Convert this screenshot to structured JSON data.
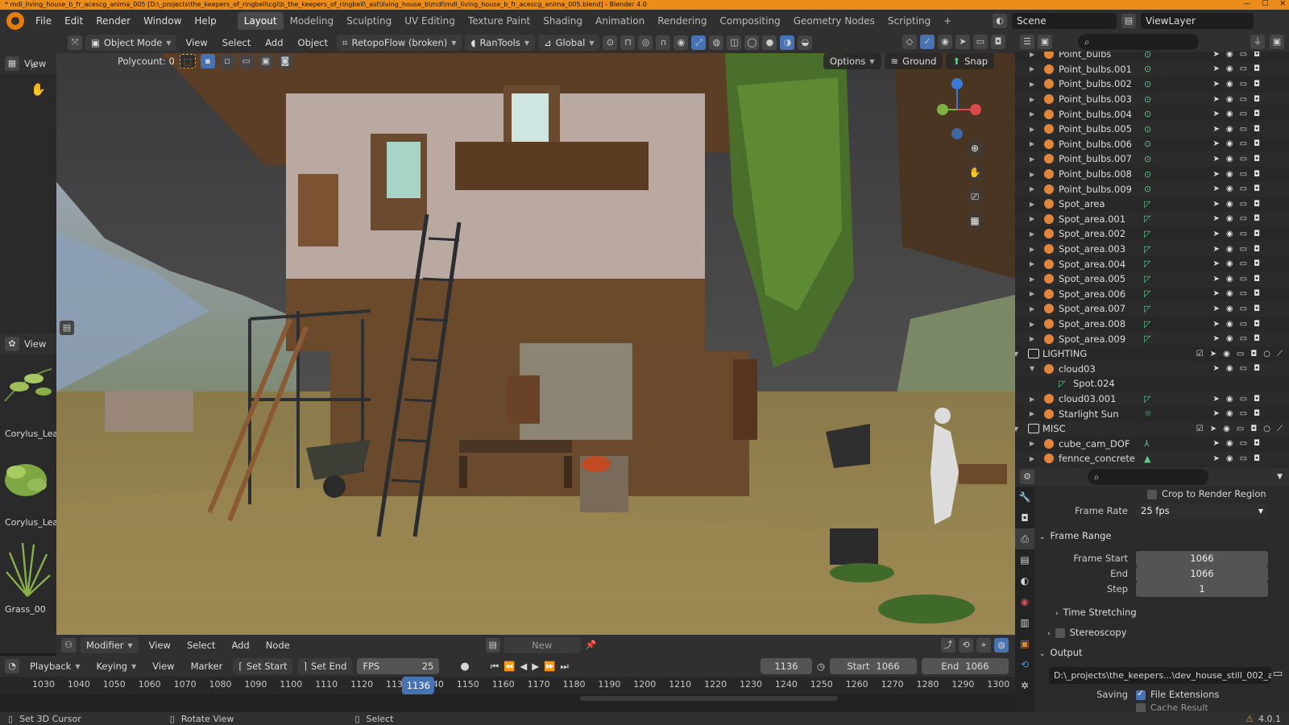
{
  "window": {
    "title": "* mdl_living_house_b_fr_acescg_anima_005 [D:\\_projects\\the_keepers_of_ringbell\\cgi\\b_the_keepers_of_ringbell\\_ast\\living_house_b\\mdl\\mdl_living_house_b_fr_acescg_anima_005.blend] - Blender 4.0",
    "version": "4.0.1"
  },
  "menubar": {
    "items": [
      "File",
      "Edit",
      "Render",
      "Window",
      "Help"
    ],
    "workspaces": [
      "Layout",
      "Modeling",
      "Sculpting",
      "UV Editing",
      "Texture Paint",
      "Shading",
      "Animation",
      "Rendering",
      "Compositing",
      "Geometry Nodes",
      "Scripting"
    ],
    "active_workspace": "Layout",
    "scene": "Scene",
    "view_layer": "ViewLayer"
  },
  "viewport_header": {
    "view_label": "View",
    "mode": "Object Mode",
    "menus": [
      "View",
      "Select",
      "Add",
      "Object"
    ],
    "retopo": "RetopoFlow (broken)",
    "rantools": "RanTools",
    "orientation": "Global",
    "polycount": "Polycount: 0",
    "options": "Options",
    "ground": "Ground",
    "snap": "Snap"
  },
  "asset_browser": {
    "view_label": "View",
    "items": [
      "Corylus_Leaf",
      "Corylus_Leaf",
      "Grass_00"
    ]
  },
  "node_header": {
    "editor": "Modifier",
    "menus": [
      "View",
      "Select",
      "Add",
      "Node"
    ],
    "new_button": "New"
  },
  "timeline": {
    "menus": [
      "Playback",
      "Keying",
      "View",
      "Marker"
    ],
    "set_start": "Set Start",
    "set_end": "Set End",
    "fps_label": "FPS",
    "fps_value": "25",
    "current_frame": "1136",
    "start_label": "Start",
    "start_value": "1066",
    "end_label": "End",
    "end_value": "1066",
    "ruler": [
      1030,
      1040,
      1050,
      1060,
      1070,
      1080,
      1090,
      1100,
      1110,
      1120,
      1130,
      1140,
      1150,
      1160,
      1170,
      1180,
      1190,
      1200,
      1210,
      1220,
      1230,
      1240,
      1250,
      1260,
      1270,
      1280,
      1290,
      1300
    ],
    "playhead": "1136"
  },
  "statusbar": {
    "items": [
      "Set 3D Cursor",
      "Rotate View",
      "Select"
    ]
  },
  "outliner": {
    "rows": [
      {
        "name": "Point_bulbs",
        "kind": "object",
        "icon": "lamp-point"
      },
      {
        "name": "Point_bulbs.001",
        "kind": "object",
        "icon": "lamp-point"
      },
      {
        "name": "Point_bulbs.002",
        "kind": "object",
        "icon": "lamp-point"
      },
      {
        "name": "Point_bulbs.003",
        "kind": "object",
        "icon": "lamp-point"
      },
      {
        "name": "Point_bulbs.004",
        "kind": "object",
        "icon": "lamp-point"
      },
      {
        "name": "Point_bulbs.005",
        "kind": "object",
        "icon": "lamp-point"
      },
      {
        "name": "Point_bulbs.006",
        "kind": "object",
        "icon": "lamp-point"
      },
      {
        "name": "Point_bulbs.007",
        "kind": "object",
        "icon": "lamp-point"
      },
      {
        "name": "Point_bulbs.008",
        "kind": "object",
        "icon": "lamp-point"
      },
      {
        "name": "Point_bulbs.009",
        "kind": "object",
        "icon": "lamp-point"
      },
      {
        "name": "Spot_area",
        "kind": "object",
        "icon": "lamp-spot"
      },
      {
        "name": "Spot_area.001",
        "kind": "object",
        "icon": "lamp-spot"
      },
      {
        "name": "Spot_area.002",
        "kind": "object",
        "icon": "lamp-spot"
      },
      {
        "name": "Spot_area.003",
        "kind": "object",
        "icon": "lamp-spot"
      },
      {
        "name": "Spot_area.004",
        "kind": "object",
        "icon": "lamp-spot"
      },
      {
        "name": "Spot_area.005",
        "kind": "object",
        "icon": "lamp-spot"
      },
      {
        "name": "Spot_area.006",
        "kind": "object",
        "icon": "lamp-spot"
      },
      {
        "name": "Spot_area.007",
        "kind": "object",
        "icon": "lamp-spot"
      },
      {
        "name": "Spot_area.008",
        "kind": "object",
        "icon": "lamp-spot"
      },
      {
        "name": "Spot_area.009",
        "kind": "object",
        "icon": "lamp-spot"
      },
      {
        "name": "LIGHTING",
        "kind": "collection",
        "icon": "collection"
      },
      {
        "name": "cloud03",
        "kind": "object-expanded",
        "icon": "object"
      },
      {
        "name": "Spot.024",
        "kind": "data",
        "icon": "lamp-spot"
      },
      {
        "name": "cloud03.001",
        "kind": "object",
        "icon": "lamp-spot"
      },
      {
        "name": "Starlight Sun",
        "kind": "object",
        "icon": "lamp-sun"
      },
      {
        "name": "MISC",
        "kind": "collection",
        "icon": "collection"
      },
      {
        "name": "cube_cam_DOF",
        "kind": "object",
        "icon": "empty"
      },
      {
        "name": "fennce_concrete",
        "kind": "object",
        "icon": "mesh"
      }
    ]
  },
  "properties": {
    "crop_label": "Crop to Render Region",
    "frame_rate_label": "Frame Rate",
    "frame_rate_value": "25 fps",
    "frame_range_panel": "Frame Range",
    "frame_start_label": "Frame Start",
    "frame_start_value": "1066",
    "end_label": "End",
    "end_value": "1066",
    "step_label": "Step",
    "step_value": "1",
    "time_stretching": "Time Stretching",
    "stereoscopy": "Stereoscopy",
    "output_panel": "Output",
    "output_path": "D:\\_projects\\the_keepers...\\dev_house_still_002_a_",
    "saving_label": "Saving",
    "file_extensions": "File Extensions",
    "cache_result": "Cache Result"
  },
  "colors": {
    "accent": "#4772b3",
    "titlebar": "#eb8d1a",
    "panel": "#303030",
    "lamp_green": "#5ecb8a"
  }
}
